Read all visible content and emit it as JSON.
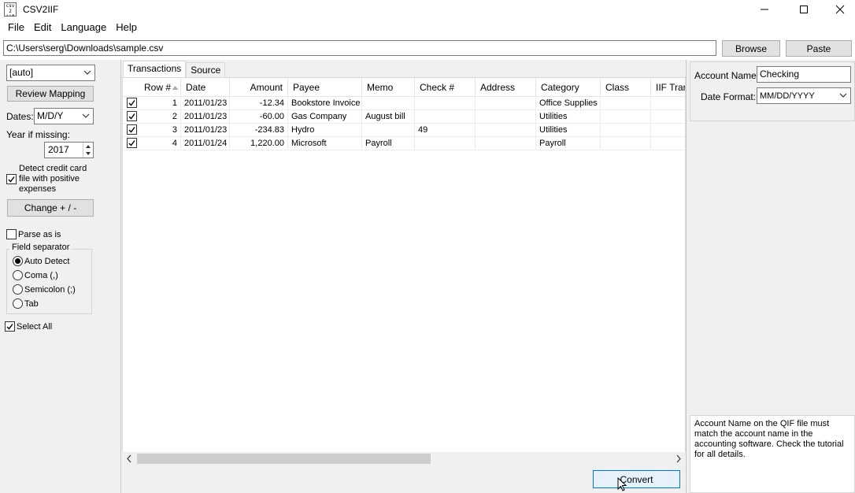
{
  "window": {
    "title": "CSV2IIF",
    "app_icon_text": "csv\n2\niif",
    "minimize": "—",
    "maximize": "☐",
    "close": "✕"
  },
  "menu": [
    "File",
    "Edit",
    "Language",
    "Help"
  ],
  "path": {
    "value": "C:\\Users\\serg\\Downloads\\sample.csv",
    "browse": "Browse",
    "paste": "Paste"
  },
  "left": {
    "mapping_select": "[auto]",
    "review_mapping": "Review Mapping",
    "dates_label": "Dates:",
    "dates_value": "M/D/Y",
    "year_label": "Year if missing:",
    "year_value": "2017",
    "detect_label": "Detect credit card file with positive expenses",
    "detect_checked": true,
    "change_sign": "Change + / -",
    "parse_as_is": "Parse as is",
    "parse_checked": false,
    "separator_title": "Field separator",
    "separators": [
      {
        "label": "Auto Detect",
        "checked": true
      },
      {
        "label": "Coma (,)",
        "checked": false
      },
      {
        "label": "Semicolon (;)",
        "checked": false
      },
      {
        "label": "Tab",
        "checked": false
      }
    ],
    "select_all": "Select All",
    "select_all_checked": true
  },
  "tabs": [
    {
      "label": "Transactions",
      "active": true
    },
    {
      "label": "Source",
      "active": false
    }
  ],
  "grid": {
    "columns": [
      "Row #",
      "Date",
      "Amount",
      "Payee",
      "Memo",
      "Check #",
      "Address",
      "Category",
      "Class",
      "IIF Trar"
    ],
    "rows": [
      {
        "checked": true,
        "row": "1",
        "date": "2011/01/23",
        "amount": "-12.34",
        "payee": "Bookstore Invoice",
        "memo": "",
        "check": "",
        "address": "",
        "category": "Office Supplies",
        "class": ""
      },
      {
        "checked": true,
        "row": "2",
        "date": "2011/01/23",
        "amount": "-60.00",
        "payee": "Gas Company",
        "memo": "August bill",
        "check": "",
        "address": "",
        "category": "Utilities",
        "class": ""
      },
      {
        "checked": true,
        "row": "3",
        "date": "2011/01/23",
        "amount": "-234.83",
        "payee": "Hydro",
        "memo": "",
        "check": "49",
        "address": "",
        "category": "Utilities",
        "class": ""
      },
      {
        "checked": true,
        "row": "4",
        "date": "2011/01/24",
        "amount": "1,220.00",
        "payee": "Microsoft",
        "memo": "Payroll",
        "check": "",
        "address": "",
        "category": "Payroll",
        "class": ""
      }
    ]
  },
  "convert": "Convert",
  "right": {
    "account_label": "Account Name:",
    "account_value": "Checking",
    "date_format_label": "Date Format:",
    "date_format_value": "MM/DD/YYYY",
    "help_text": "Account Name on the QIF file must match the account name in the accounting software. Check the tutorial for all details."
  }
}
